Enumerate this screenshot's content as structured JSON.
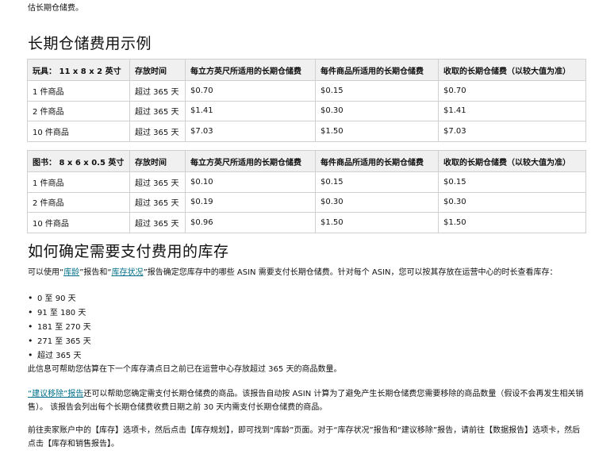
{
  "top_text": "估长期仓储费。",
  "section_example": {
    "heading": "长期仓储费用示例",
    "tables": [
      {
        "headers": [
          "玩具： 11 x 8 x 2 英寸",
          "存放时间",
          "每立方英尺所适用的长期仓储费",
          "每件商品所适用的长期仓储费",
          "收取的长期仓储费（以较大值为准）"
        ],
        "rows": [
          [
            "1 件商品",
            "超过 365 天",
            "$0.70",
            "$0.15",
            "$0.70"
          ],
          [
            "2 件商品",
            "超过 365 天",
            "$1.41",
            "$0.30",
            "$1.41"
          ],
          [
            "10 件商品",
            "超过 365 天",
            "$7.03",
            "$1.50",
            "$7.03"
          ]
        ]
      },
      {
        "headers": [
          "图书： 8 x 6 x 0.5 英寸",
          "存放时间",
          "每立方英尺所适用的长期仓储费",
          "每件商品所适用的长期仓储费",
          "收取的长期仓储费（以较大值为准）"
        ],
        "rows": [
          [
            "1 件商品",
            "超过 365 天",
            "$0.10",
            "$0.15",
            "$0.15"
          ],
          [
            "2 件商品",
            "超过 365 天",
            "$0.19",
            "$0.30",
            "$0.30"
          ],
          [
            "10 件商品",
            "超过 365 天",
            "$0.96",
            "$1.50",
            "$1.50"
          ]
        ]
      }
    ]
  },
  "section_determine": {
    "heading": "如何确定需要支付费用的库存",
    "intro": {
      "before_link1": "可以使用“",
      "link1": "库龄",
      "between_links": "”报告和“",
      "link2": "库存状况",
      "after_link2": "”报告确定您库存中的哪些 ASIN 需要支付长期仓储费。针对每个 ASIN，您可以按其存放在运营中心的时长查看库存："
    },
    "periods": [
      "0 至 90 天",
      "91 至 180 天",
      "181 至 270 天",
      "271 至 365 天",
      "超过 365 天"
    ],
    "estimate_text": "此信息可帮助您估算在下一个库存清点日之前已在运营中心存放超过 365 天的商品数量。",
    "recommend": {
      "link": "“建议移除”报告",
      "text": "还可以帮助您确定需支付长期仓储费的商品。该报告自动按 ASIN 计算为了避免产生长期仓储费您需要移除的商品数量（假设不会再发生相关销售）。 该报告会列出每个长期仓储费收费日期之前 30 天内需支付长期仓储费的商品。"
    },
    "navigate_text": "前往卖家账户中的【库存】选项卡，然后点击【库存规划】，即可找到“库龄”页面。对于“库存状况”报告和“建议移除”报告，请前往【数据报告】选项卡，然后点击【库存和销售报告】。"
  }
}
